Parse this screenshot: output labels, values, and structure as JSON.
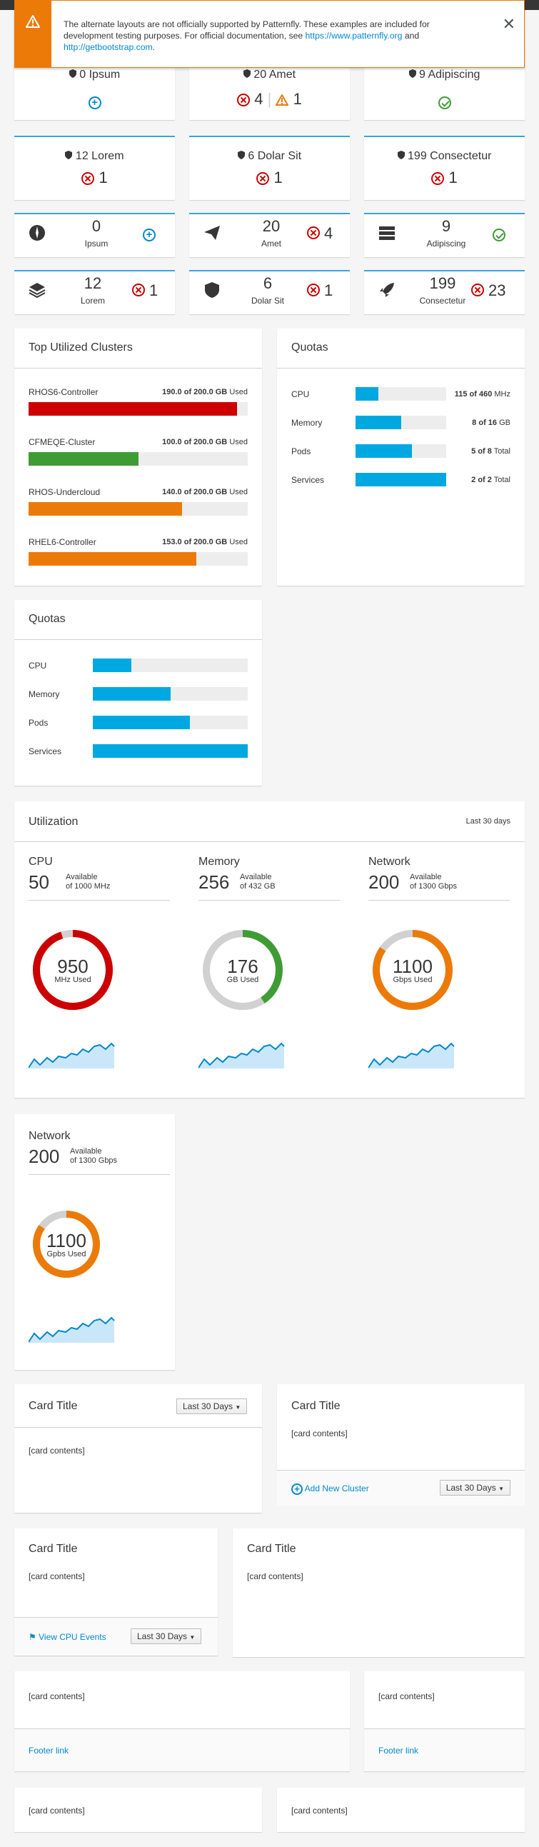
{
  "alert": {
    "text": "The alternate layouts are not officially supported by Patternfly. These examples are included for development testing purposes. For official documentation, see",
    "link1": "https://www.patternfly.org",
    "and": "and",
    "link2": "http://getbootstrap.com",
    "end": "."
  },
  "agg1": [
    {
      "count": "0",
      "label": "Ipsum"
    },
    {
      "count": "20",
      "label": "Amet",
      "err": "4",
      "warn": "1"
    },
    {
      "count": "9",
      "label": "Adipiscing"
    }
  ],
  "agg2": [
    {
      "count": "12",
      "label": "Lorem",
      "err": "1"
    },
    {
      "count": "6",
      "label": "Dolar Sit",
      "err": "1"
    },
    {
      "count": "199",
      "label": "Consectetur",
      "err": "1"
    }
  ],
  "mini1": [
    {
      "count": "0",
      "label": "Ipsum"
    },
    {
      "count": "20",
      "label": "Amet",
      "err": "4"
    },
    {
      "count": "9",
      "label": "Adipiscing"
    }
  ],
  "mini2": [
    {
      "count": "12",
      "label": "Lorem",
      "err": "1"
    },
    {
      "count": "6",
      "label": "Dolar Sit",
      "err": "1"
    },
    {
      "count": "199",
      "label": "Consectetur",
      "err": "23"
    }
  ],
  "clusters": {
    "title": "Top Utilized Clusters",
    "items": [
      {
        "name": "RHOS6-Controller",
        "used": "190.0",
        "total": "of 200.0 GB",
        "unit": "Used",
        "pct": 95,
        "color": "#cc0000"
      },
      {
        "name": "CFMEQE-Cluster",
        "used": "100.0",
        "total": "of 200.0 GB",
        "unit": "Used",
        "pct": 50,
        "color": "#3f9c35"
      },
      {
        "name": "RHOS-Undercloud",
        "used": "140.0",
        "total": "of 200.0 GB",
        "unit": "Used",
        "pct": 70,
        "color": "#ec7a08"
      },
      {
        "name": "RHEL6-Controller",
        "used": "153.0",
        "total": "of 200.0 GB",
        "unit": "Used",
        "pct": 76.5,
        "color": "#ec7a08"
      }
    ]
  },
  "quotas": {
    "title": "Quotas",
    "items": [
      {
        "name": "CPU",
        "val": "115 of 460",
        "unit": "MHz",
        "pct": 25
      },
      {
        "name": "Memory",
        "val": "8 of 16",
        "unit": "GB",
        "pct": 50
      },
      {
        "name": "Pods",
        "val": "5 of 8",
        "unit": "Total",
        "pct": 62.5
      },
      {
        "name": "Services",
        "val": "2 of 2",
        "unit": "Total",
        "pct": 100
      }
    ]
  },
  "quotas2": {
    "title": "Quotas",
    "items": [
      {
        "name": "CPU",
        "pct": 25
      },
      {
        "name": "Memory",
        "pct": 50
      },
      {
        "name": "Pods",
        "pct": 62.5
      },
      {
        "name": "Services",
        "pct": 100
      }
    ]
  },
  "utilization": {
    "title": "Utilization",
    "period": "Last 30 days",
    "items": [
      {
        "name": "CPU",
        "avail": "50",
        "avail_label": "Available",
        "of": "of 1000 MHz",
        "used": "950",
        "used_label": "MHz Used",
        "color": "#cc0000",
        "pct": 95
      },
      {
        "name": "Memory",
        "avail": "256",
        "avail_label": "Available",
        "of": "of 432 GB",
        "used": "176",
        "used_label": "GB Used",
        "color": "#3f9c35",
        "pct": 40.7
      },
      {
        "name": "Network",
        "avail": "200",
        "avail_label": "Available",
        "of": "of 1300 Gbps",
        "used": "1100",
        "used_label": "Gbps Used",
        "color": "#ec7a08",
        "pct": 84.6
      }
    ]
  },
  "network_card": {
    "name": "Network",
    "avail": "200",
    "avail_label": "Available",
    "of": "of 1300 Gbps",
    "used": "1100",
    "used_label": "Gpbs Used",
    "color": "#ec7a08",
    "pct": 84.6
  },
  "cards": {
    "title": "Card Title",
    "contents": "[card contents]",
    "last30": "Last 30 Days",
    "add_cluster": "Add New Cluster",
    "view_cpu": "View CPU Events",
    "footer_link": "Footer link"
  },
  "colors": {
    "accent": "#39a5dc",
    "blue": "#0088ce",
    "fill": "#00a8e1"
  }
}
